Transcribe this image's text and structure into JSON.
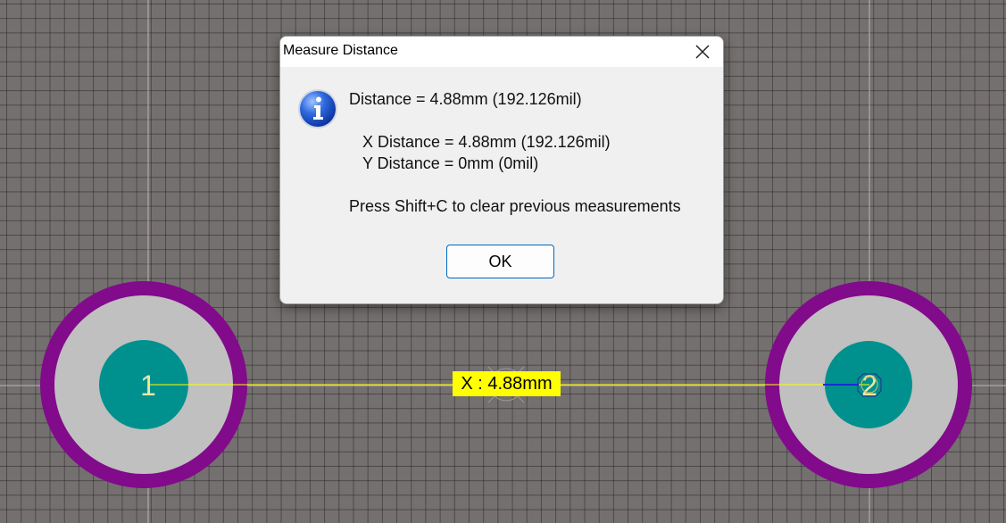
{
  "dialog": {
    "title": "Measure Distance",
    "icon": "info-icon",
    "distance_line": "Distance = 4.88mm (192.126mil)",
    "x_distance_line": "X Distance = 4.88mm (192.126mil)",
    "y_distance_line": "Y Distance = 0mm (0mil)",
    "hint_line": "Press Shift+C to clear previous measurements",
    "ok_label": "OK",
    "close_icon": "close-icon"
  },
  "board": {
    "pad1_label": "1",
    "pad2_label": "2",
    "measure_label": "X : 4.88mm",
    "colors": {
      "background": "#74706f",
      "grid": "#3a3838",
      "pad_ring": "#810b8a",
      "pad_copper": "#c0c0c0",
      "pad_hole": "#00918e",
      "pad_text": "#e8e8a8",
      "measure_line": "#ffff00",
      "measure_label_bg": "#ffff00"
    }
  }
}
